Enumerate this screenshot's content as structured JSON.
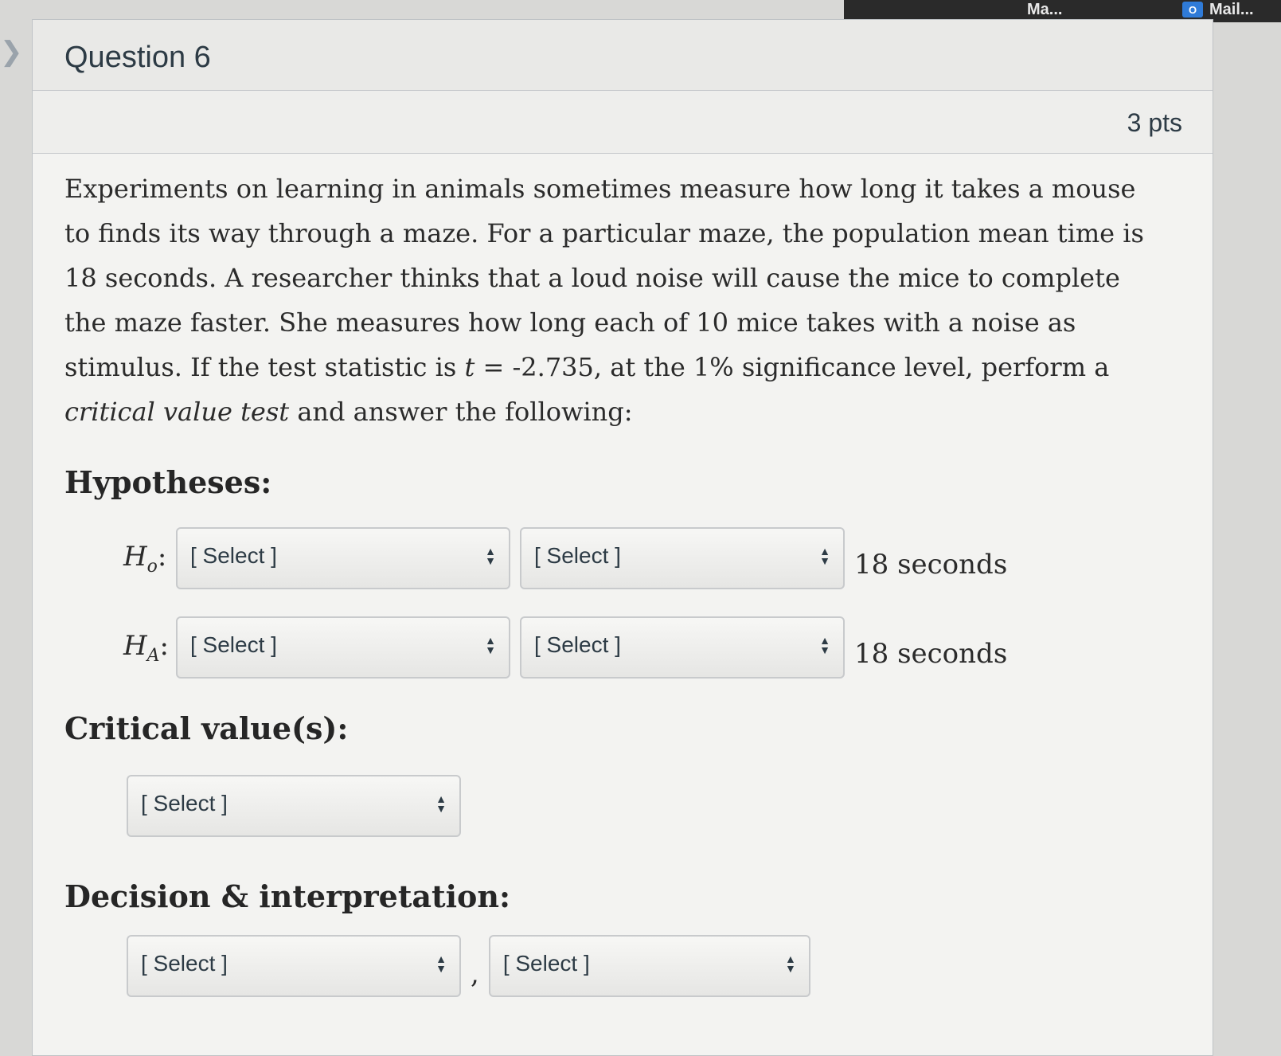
{
  "taskbar": {
    "items": [
      {
        "label": "Ma...",
        "icon": "app-icon"
      },
      {
        "label": "Mail...",
        "icon": "outlook-icon",
        "icon_glyph": "O"
      }
    ]
  },
  "question": {
    "title": "Question 6",
    "points": "3 pts",
    "prompt_before_t": "Experiments on learning in animals sometimes measure how long it takes a mouse to finds its way through a maze. For a particular maze, the population mean time is 18 seconds. A researcher thinks that a loud noise will cause the mice to complete the maze faster. She measures how long each of 10 mice takes with a noise as stimulus. If the test statistic is ",
    "t_symbol": "t",
    "prompt_after_t": " = -2.735, at the 1% significance level, perform a ",
    "prompt_italic": "critical value test",
    "prompt_end": " and answer the following:"
  },
  "hypotheses": {
    "heading": "Hypotheses:",
    "h0": {
      "label": "H",
      "sub": "o",
      "colon": ":",
      "select1": "[ Select ]",
      "select2": "[ Select ]",
      "unit": "18 seconds"
    },
    "ha": {
      "label": "H",
      "sub": "A",
      "colon": ":",
      "select1": "[ Select ]",
      "select2": "[ Select ]",
      "unit": "18 seconds"
    }
  },
  "critical": {
    "heading": "Critical value(s):",
    "select": "[ Select ]"
  },
  "decision": {
    "heading": "Decision & interpretation:",
    "select1": "[ Select ]",
    "separator": ",",
    "select2": "[ Select ]"
  },
  "colors": {
    "text": "#2d3b45",
    "card_bg": "#f3f3f1",
    "header_bg": "#e9e9e7"
  }
}
